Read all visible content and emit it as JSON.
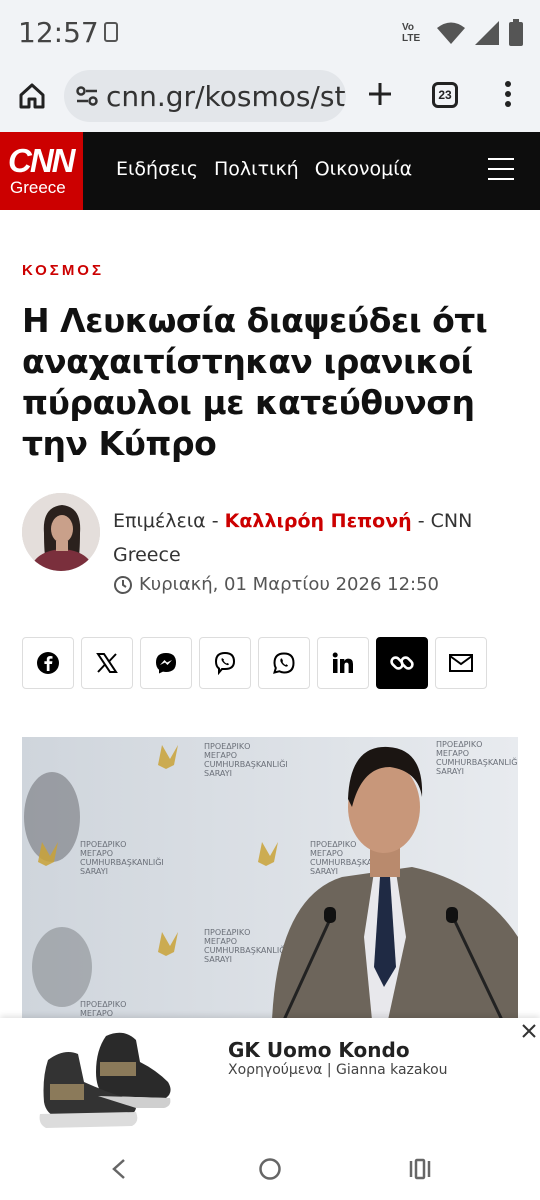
{
  "status_bar": {
    "time": "12:57",
    "network": "Vo LTE"
  },
  "browser": {
    "url": "cnn.gr/kosmos/st",
    "tab_count": "23"
  },
  "site": {
    "logo_top": "CNN",
    "logo_bottom": "Greece",
    "nav": [
      "Ειδήσεις",
      "Πολιτική",
      "Οικονομία"
    ]
  },
  "article": {
    "category": "ΚΟΣΜΟΣ",
    "headline": "Η Λευκωσία διαψεύδει ότι αναχαιτίστηκαν ιρανικοί πύραυλοι με κατεύθυνση την Κύπρο",
    "byline_prefix": "Επιμέλεια - ",
    "author": "Καλλιρόη Πεπονή",
    "byline_suffix": " - CNN Greece",
    "date": "Κυριακή, 01 Μαρτίου 2026 12:50"
  },
  "photo_backdrop": {
    "line1": "ΠΡΟΕΔΡΙΚΟ",
    "line2": "ΜΕΓΑΡΟ",
    "line3": "CUMHURBAŞKANLIĞI",
    "line4": "SARAYI"
  },
  "ad": {
    "title": "GK Uomo Kondo",
    "sponsor": "Χορηγούμενα | Gianna kazakou"
  },
  "colors": {
    "brand_red": "#cc0000",
    "header_bg": "#0d0d0d",
    "chrome_bg": "#f1f3f6"
  }
}
